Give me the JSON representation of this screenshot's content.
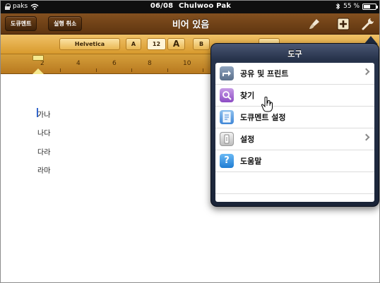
{
  "status_bar": {
    "carrier": "paks",
    "time": "06/08",
    "overlay_name": "Chulwoo Pak",
    "battery": "55 %",
    "battery_level": 0.55
  },
  "toolbar": {
    "documents_label": "도큐멘트",
    "undo_label": "실행 취소",
    "title": "비어 있음",
    "icons": [
      "paintbrush-icon",
      "plus-icon",
      "wrench-icon"
    ]
  },
  "format_bar": {
    "font_name": "Helvetica",
    "font_size": "12",
    "font_decrease": "A",
    "font_increase": "A",
    "bold": "B"
  },
  "ruler": {
    "numbers": [
      "2",
      "4",
      "6",
      "8",
      "10"
    ]
  },
  "document": {
    "lines": [
      "가나",
      "나다",
      "다라",
      "라마"
    ]
  },
  "popover": {
    "title": "도구",
    "items": [
      {
        "label": "공유 및 프린트",
        "icon": "share-icon",
        "has_chevron": true
      },
      {
        "label": "찾기",
        "icon": "search-icon",
        "has_chevron": false
      },
      {
        "label": "도큐멘트 설정",
        "icon": "document-setup-icon",
        "has_chevron": false
      },
      {
        "label": "설정",
        "icon": "settings-icon",
        "has_chevron": true
      },
      {
        "label": "도움말",
        "icon": "help-icon",
        "has_chevron": false
      }
    ],
    "help_glyph": "?"
  },
  "colors": {
    "toolbar_brown": "#6b3f15",
    "format_bar_gold": "#e3ab3e",
    "popover_navy": "#27334b"
  }
}
